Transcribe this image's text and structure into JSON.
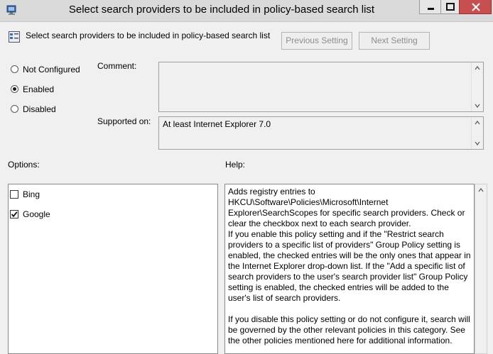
{
  "window": {
    "title": "Select search providers to be included in policy-based search list"
  },
  "header": {
    "title": "Select search providers to be included in policy-based search list",
    "previous_label": "Previous Setting",
    "next_label": "Next Setting"
  },
  "state": {
    "options": [
      {
        "label": "Not Configured",
        "selected": false
      },
      {
        "label": "Enabled",
        "selected": true
      },
      {
        "label": "Disabled",
        "selected": false
      }
    ]
  },
  "comment": {
    "label": "Comment:",
    "value": ""
  },
  "supported": {
    "label": "Supported on:",
    "value": "At least Internet Explorer 7.0"
  },
  "options_panel": {
    "label": "Options:",
    "items": [
      {
        "label": "Bing",
        "checked": false
      },
      {
        "label": "Google",
        "checked": true
      }
    ]
  },
  "help_panel": {
    "label": "Help:",
    "paragraphs": [
      "Adds registry entries to HKCU\\Software\\Policies\\Microsoft\\Internet Explorer\\SearchScopes for specific search providers. Check or clear the checkbox next to each search provider.",
      " If you enable this policy setting and if the \"Restrict search providers to a specific list of providers\" Group Policy setting is enabled, the checked entries will be the only ones that appear in the Internet Explorer drop-down list. If the \"Add a specific list of search providers to the user's search provider list\" Group Policy setting is enabled, the checked entries will be added to the user's list of search providers.",
      " If you disable this policy setting or do not configure it, search will be governed by the other relevant policies in this category. See the other policies mentioned here for additional information."
    ]
  },
  "icons": {
    "app": "group-policy-icon",
    "header": "policy-setting-icon"
  }
}
